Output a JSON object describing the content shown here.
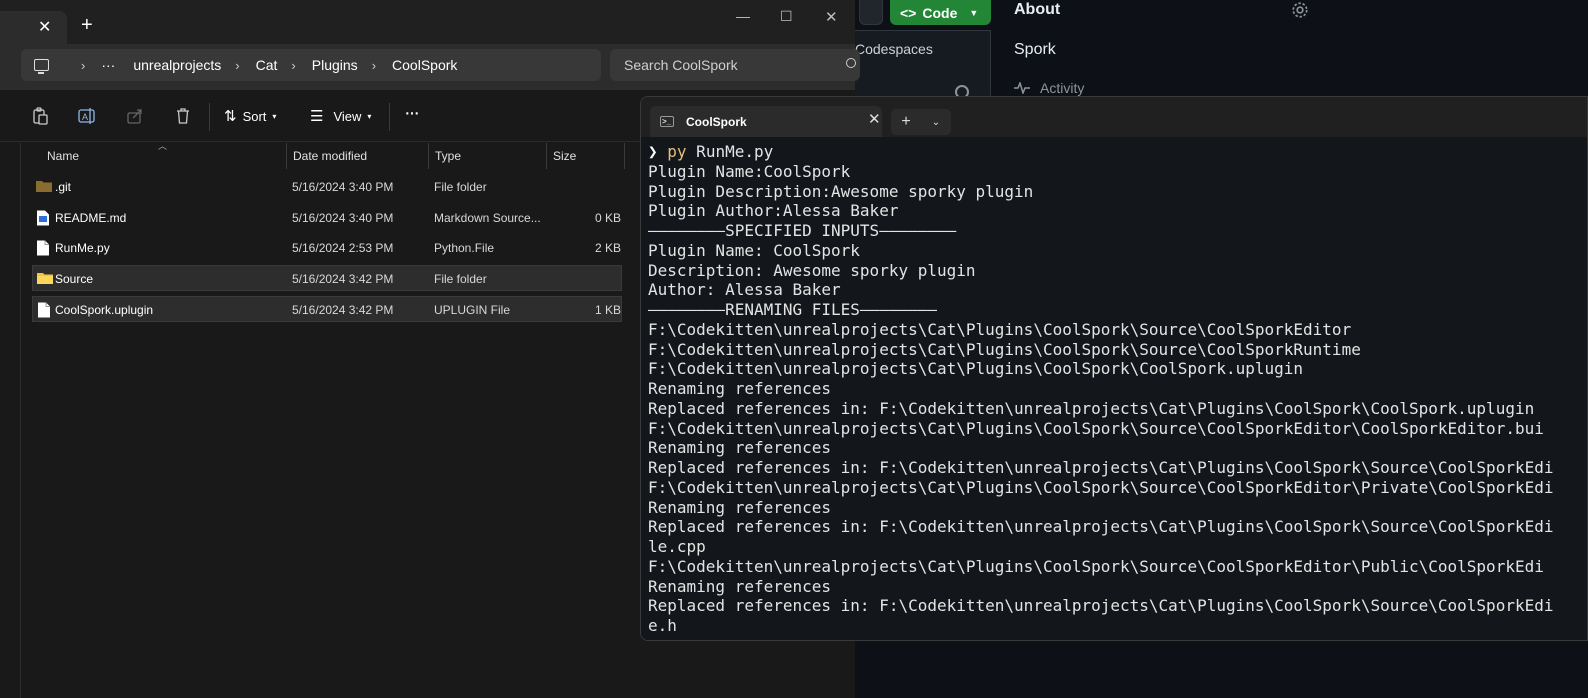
{
  "github": {
    "code_label": "Code",
    "codespaces_label": "Codespaces",
    "about_heading": "About",
    "repo_description": "Spork",
    "activity_label": "Activity"
  },
  "explorer": {
    "breadcrumb": [
      "unrealprojects",
      "Cat",
      "Plugins",
      "CoolSpork"
    ],
    "search_placeholder": "Search CoolSpork",
    "toolbar": {
      "sort_label": "Sort",
      "view_label": "View",
      "more_label": "···"
    },
    "columns": [
      "Name",
      "Date modified",
      "Type",
      "Size"
    ],
    "files": [
      {
        "name": ".git",
        "date": "5/16/2024 3:40 PM",
        "type": "File folder",
        "size": "",
        "icon": "folder-dim-icon"
      },
      {
        "name": "README.md",
        "date": "5/16/2024 3:40 PM",
        "type": "Markdown Source...",
        "size": "0 KB",
        "icon": "markdown-file-icon"
      },
      {
        "name": "RunMe.py",
        "date": "5/16/2024 2:53 PM",
        "type": "Python.File",
        "size": "2 KB",
        "icon": "file-icon"
      },
      {
        "name": "Source",
        "date": "5/16/2024 3:42 PM",
        "type": "File folder",
        "size": "",
        "icon": "folder-icon"
      },
      {
        "name": "CoolSpork.uplugin",
        "date": "5/16/2024 3:42 PM",
        "type": "UPLUGIN File",
        "size": "1 KB",
        "icon": "file-icon"
      }
    ]
  },
  "terminal": {
    "tab_title": "CoolSpork",
    "prompt_cmd": "py",
    "prompt_args": " RunMe.py",
    "lines": [
      "Plugin Name:CoolSpork",
      "Plugin Description:Awesome sporky plugin",
      "Plugin Author:Alessa Baker",
      "————————SPECIFIED INPUTS————————",
      "Plugin Name: CoolSpork",
      "Description: Awesome sporky plugin",
      "Author: Alessa Baker",
      "————————RENAMING FILES————————",
      "F:\\Codekitten\\unrealprojects\\Cat\\Plugins\\CoolSpork\\Source\\CoolSporkEditor",
      "F:\\Codekitten\\unrealprojects\\Cat\\Plugins\\CoolSpork\\Source\\CoolSporkRuntime",
      "F:\\Codekitten\\unrealprojects\\Cat\\Plugins\\CoolSpork\\CoolSpork.uplugin",
      "Renaming references",
      "Replaced references in: F:\\Codekitten\\unrealprojects\\Cat\\Plugins\\CoolSpork\\CoolSpork.uplugin",
      "F:\\Codekitten\\unrealprojects\\Cat\\Plugins\\CoolSpork\\Source\\CoolSporkEditor\\CoolSporkEditor.bui",
      "Renaming references",
      "Replaced references in: F:\\Codekitten\\unrealprojects\\Cat\\Plugins\\CoolSpork\\Source\\CoolSporkEdi",
      "F:\\Codekitten\\unrealprojects\\Cat\\Plugins\\CoolSpork\\Source\\CoolSporkEditor\\Private\\CoolSporkEdi",
      "Renaming references",
      "Replaced references in: F:\\Codekitten\\unrealprojects\\Cat\\Plugins\\CoolSpork\\Source\\CoolSporkEdi",
      "le.cpp",
      "F:\\Codekitten\\unrealprojects\\Cat\\Plugins\\CoolSpork\\Source\\CoolSporkEditor\\Public\\CoolSporkEdi",
      "Renaming references",
      "Replaced references in: F:\\Codekitten\\unrealprojects\\Cat\\Plugins\\CoolSpork\\Source\\CoolSporkEdi",
      "e.h"
    ]
  }
}
